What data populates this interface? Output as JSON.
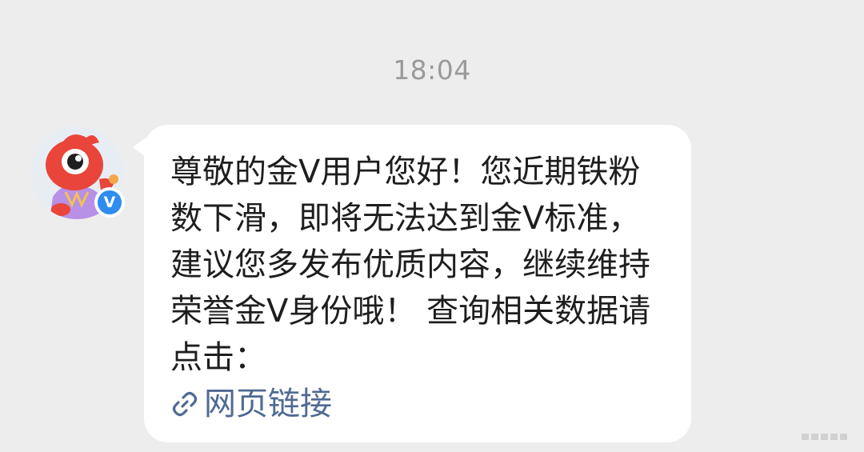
{
  "chat": {
    "timestamp": "18:04",
    "sender": {
      "avatar_icon": "weibo-mascot-avatar",
      "badge_icon": "verified-v-badge",
      "badge_letter": "V",
      "badge_color": "#2f8cf0"
    },
    "message": {
      "text": "尊敬的金V用户您好！您近期铁粉数下滑，即将无法达到金V标准，建议您多发布优质内容，继续维持荣誉金V身份哦！ 查询相关数据请点击：",
      "link_icon": "link-icon",
      "link_text": "网页链接",
      "link_color": "#4f6a94"
    }
  }
}
